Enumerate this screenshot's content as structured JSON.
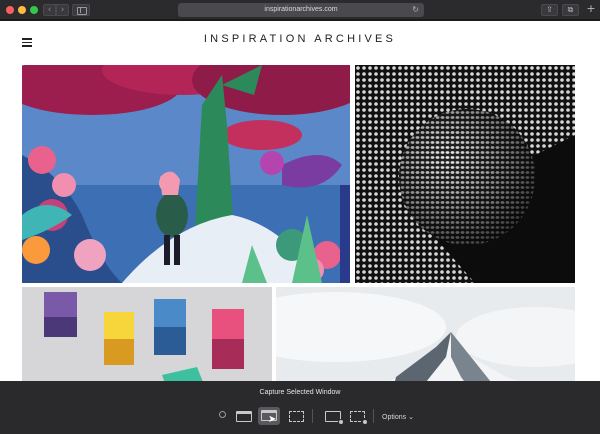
{
  "browser": {
    "url": "inspirationarchives.com",
    "back_icon": "chevron-left-icon",
    "forward_icon": "chevron-right-icon",
    "reload_glyph": "↻",
    "share_glyph": "⇪",
    "tabs_glyph": "⧉",
    "plus_glyph": "+"
  },
  "site": {
    "title": "INSPIRATION ARCHIVES"
  },
  "screenshot_toolbar": {
    "label": "Capture Selected Window",
    "options_label": "Options ⌄",
    "tools": [
      "close",
      "capture-entire-screen",
      "capture-selected-window",
      "capture-selected-portion",
      "record-entire-screen",
      "record-selected-portion"
    ]
  },
  "colors": {
    "chrome": "#2b2b2e",
    "page": "#ffffff",
    "toolbar": "#2a2a2c"
  }
}
